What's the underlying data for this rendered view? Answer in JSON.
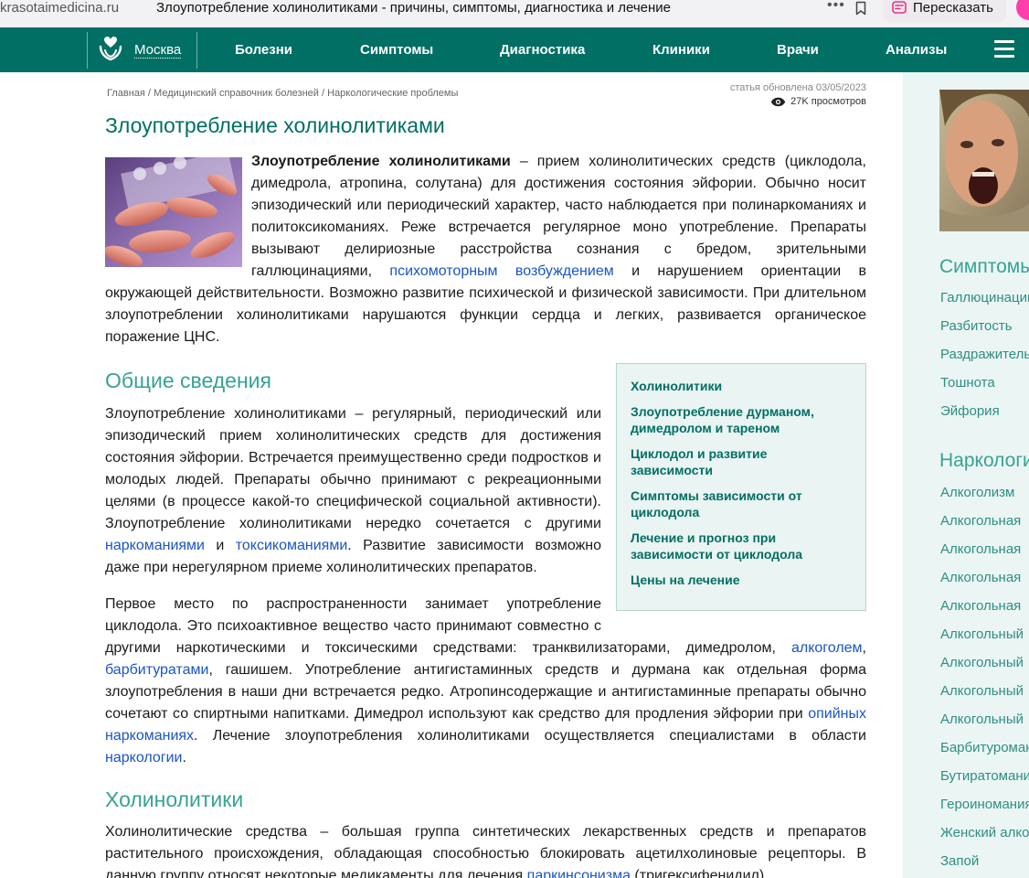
{
  "browser": {
    "url_host": "krasotaimedicina.ru",
    "tab_title": "Злоупотребление холинолитиками - причины, симптомы, диагностика и лечение",
    "dots": "•••",
    "retell_label": "Пересказать"
  },
  "nav": {
    "city": "Москва",
    "items": [
      {
        "label": "Болезни"
      },
      {
        "label": "Симптомы"
      },
      {
        "label": "Диагностика"
      },
      {
        "label": "Клиники"
      },
      {
        "label": "Врачи"
      },
      {
        "label": "Анализы"
      }
    ]
  },
  "breadcrumb": {
    "items": [
      "Главная",
      "Медицинский справочник болезней",
      "Наркологические проблемы"
    ],
    "separator": " / "
  },
  "meta": {
    "updated": "статья обновлена 03/05/2023",
    "views": "27K просмотров"
  },
  "article": {
    "title": "Злоупотребление холинолитиками",
    "intro": {
      "bold": "Злоупотребление холинолитиками",
      "part1": " – прием холинолитических средств (циклодола, димедрола, атропина, солутана) для достижения состояния эйфории. Обычно носит эпизодический или периодический характер, часто наблюдается при полинаркоманиях и политоксикоманиях. Реже встречается регулярное моно употребление. Препараты вызывают делириозные расстройства сознания с бредом, зрительными галлюцинациями, ",
      "link1": "психомоторным возбуждением",
      "part2": " и нарушением ориентации в окружающей действительности. Возможно развитие психической и физической зависимости. При длительном злоупотреблении холинолитиками нарушаются функции сердца и легких, развивается органическое поражение ЦНС."
    },
    "section1_title": "Общие сведения",
    "p1": {
      "part1": "Злоупотребление холинолитиками – регулярный, периодический или эпизодический прием холинолитических средств для достижения состояния эйфории. Встречается преимущественно среди подростков и молодых людей. Препараты обычно принимают с рекреационными целями (в процессе какой-то специфической социальной активности). Злоупотребление холинолитиками нередко сочетается с другими ",
      "link1": "наркоманиями",
      "part2": " и ",
      "link2": "токсикоманиями",
      "part3": ". Развитие зависимости возможно даже при нерегулярном приеме холинолитических препаратов."
    },
    "p2": {
      "part1": "Первое место по распространенности занимает употребление циклодола. Это психоактивное вещество часто принимают совместно с другими наркотическими и токсическими средствами: транквилизаторами, димедролом, ",
      "link1": "алкоголем",
      "part2": ", ",
      "link2": "барбитуратами",
      "part3": ", гашишем. Употребление антигистаминных средств и дурмана как отдельная форма злоупотребления в наши дни встречается редко. Атропинсодержащие и антигистаминные препараты обычно сочетают со спиртными напитками. Димедрол используют как средство для продления эйфории при ",
      "link3": "опийных наркоманиях",
      "part4": ". Лечение злоупотребления холинолитиками осуществляется специалистами в области ",
      "link4": "наркологии",
      "part5": "."
    },
    "section2_title": "Холинолитики",
    "p3": {
      "part1": "Холинолитические средства – большая группа синтетических лекарственных средств и препаратов растительного происхождения, обладающая способностью блокировать ацетилхолиновые рецепторы. В данную группу относят некоторые медикаменты для лечения ",
      "link1": "паркинсонизма",
      "part2": " (тригексифенидил)"
    }
  },
  "toc": {
    "items": [
      {
        "label": "Холинолитики"
      },
      {
        "label": "Злоупотребление дурманом, димедролом и тареном"
      },
      {
        "label": "Циклодол и развитие зависимости"
      },
      {
        "label": "Симптомы зависимости от циклодола"
      },
      {
        "label": "Лечение и прогноз при зависимости от циклодола"
      },
      {
        "label": "Цены на лечение"
      }
    ]
  },
  "sidebar": {
    "symptoms_title": "Симптомы",
    "symptoms": [
      "Галлюцинации",
      "Разбитость",
      "Раздражительность",
      "Тошнота",
      "Эйфория"
    ],
    "narcology_title": "Наркология",
    "narcology": [
      "Алкоголизм",
      "Алкогольная",
      "Алкогольная",
      "Алкогольная",
      "Алкогольная",
      "Алкогольный",
      "Алкогольный",
      "Алкогольный",
      "Алкогольный",
      "Барбитуромания",
      "Бутиратомания",
      "Героиномания",
      "Женский алкоголизм",
      "Запой"
    ]
  },
  "colors": {
    "nav_bg": "#016f63",
    "title": "#016f63",
    "section_title": "#36a394",
    "link": "#1a55c4",
    "toc_bg": "#eaf4f2",
    "sidebar_bg": "#ebf6f4"
  }
}
